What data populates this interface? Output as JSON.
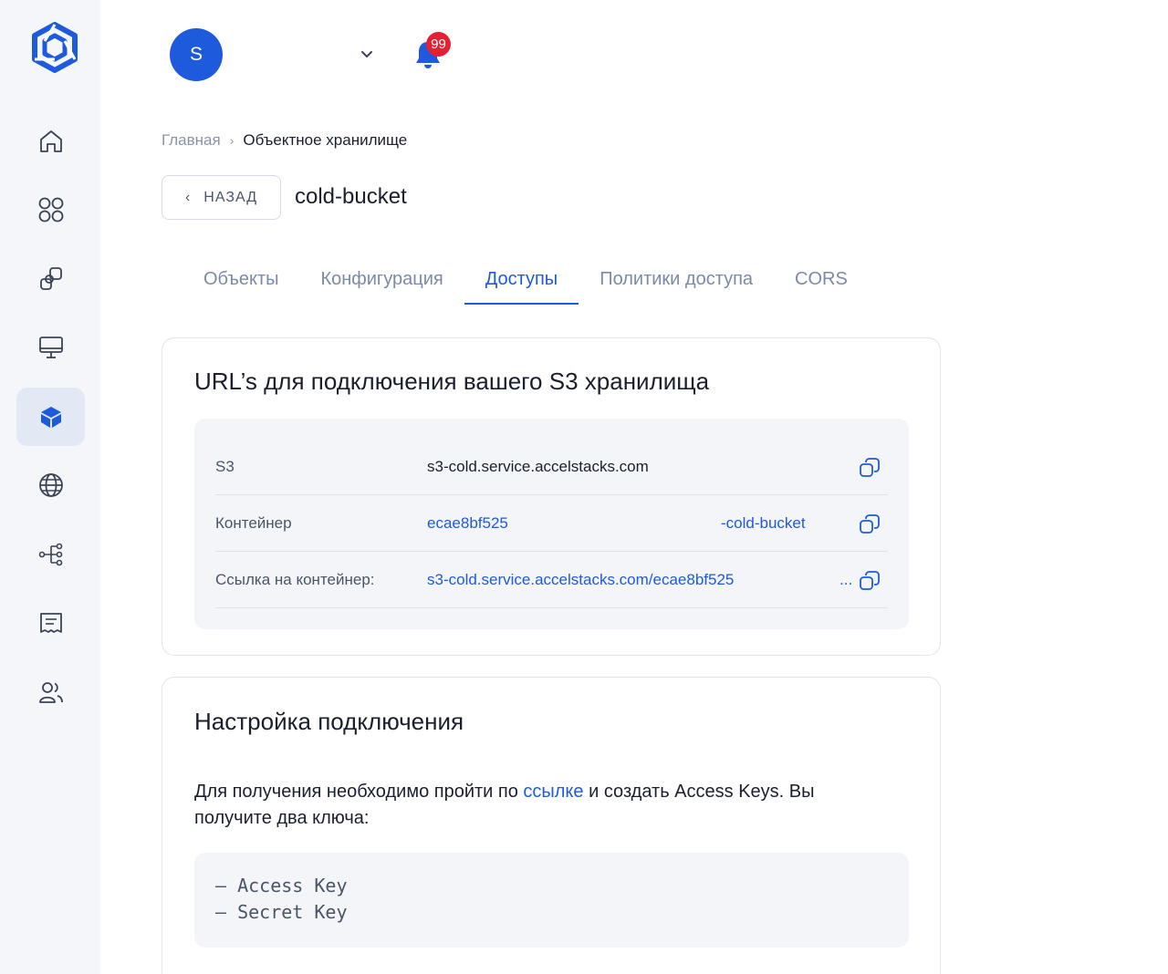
{
  "header": {
    "avatar_initial": "S",
    "notifications_count": "99"
  },
  "breadcrumb": {
    "home": "Главная",
    "separator": "›",
    "current": "Объектное хранилище"
  },
  "back_button": {
    "icon": "‹",
    "label": "НАЗАД"
  },
  "page_title": "cold-bucket",
  "tabs": [
    {
      "label": "Объекты",
      "active": false
    },
    {
      "label": "Конфигурация",
      "active": false
    },
    {
      "label": "Доступы",
      "active": true
    },
    {
      "label": "Политики доступа",
      "active": false
    },
    {
      "label": "CORS",
      "active": false
    }
  ],
  "urls_card": {
    "title": "URL’s для подключения вашего S3 хранилища",
    "rows": [
      {
        "label": "S3",
        "value": "s3-cold.service.accelstacks.com"
      },
      {
        "label": "Контейнер",
        "value_start": "ecae8bf525",
        "value_end": "-cold-bucket"
      },
      {
        "label": "Ссылка на контейнер:",
        "value_start": "s3-cold.service.accelstacks.com/ecae8bf525",
        "value_end": "..."
      }
    ]
  },
  "connection_card": {
    "title": "Настройка подключения",
    "desc_before": "Для получения необходимо пройти по ",
    "desc_link": "ссылке",
    "desc_after": " и создать Access Keys. Вы получите два ключа:",
    "code": "– Access Key\n– Secret Key"
  },
  "colors": {
    "accent": "#1e5bdc",
    "badge": "#e62033",
    "sidebar_bg": "#f4f6f9",
    "active_nav_bg": "#e3e9f4"
  }
}
